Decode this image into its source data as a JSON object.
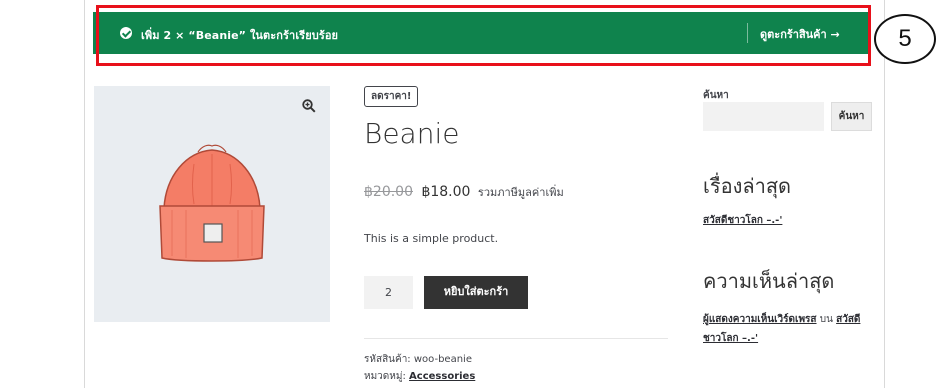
{
  "notice": {
    "message": "เพิ่ม 2 × “Beanie” ในตะกร้าเรียบร้อย",
    "view_cart": "ดูตะกร้าสินค้า →",
    "bg_color": "#0f834d"
  },
  "annotation": {
    "step_number": "5",
    "highlight_color": "#e8101a"
  },
  "product": {
    "sale_badge": "ลดราคา!",
    "title": "Beanie",
    "old_price": "฿20.00",
    "new_price": "฿18.00",
    "tax_note": "รวมภาษีมูลค่าเพิ่ม",
    "short_description": "This is a simple product.",
    "quantity": "2",
    "add_to_cart": "หยิบใส่ตะกร้า",
    "sku_label": "รหัสสินค้า:",
    "sku_value": "woo-beanie",
    "category_label": "หมวดหมู่:",
    "category_value": "Accessories",
    "image_icon": "beanie-hat",
    "zoom_icon": "zoom-in-icon"
  },
  "sidebar": {
    "search_label": "ค้นหา",
    "search_placeholder": "",
    "search_button": "ค้นหา",
    "recent_posts_title": "เรื่องล่าสุด",
    "recent_post_1": "สวัสดีชาวโลก –.-'",
    "recent_comments_title": "ความเห็นล่าสุด",
    "comment_author": "ผู้แสดงความเห็นเวิร์ดเพรส",
    "comment_on": "บน",
    "comment_post": "สวัสดีชาวโลก –.-'"
  }
}
